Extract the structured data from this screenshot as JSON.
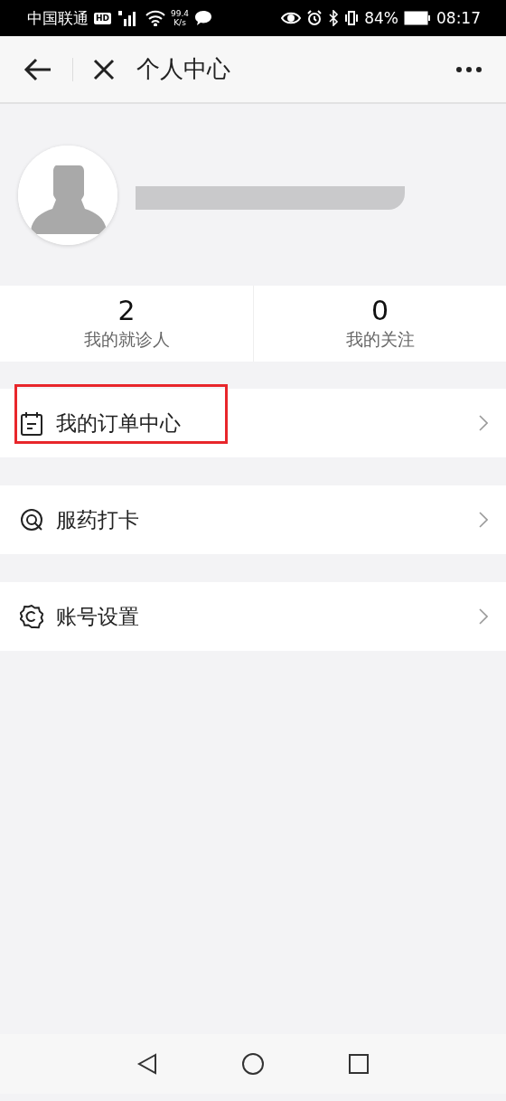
{
  "status_bar": {
    "carrier": "中国联通",
    "network_badge": "HD",
    "speed_value": "99.4",
    "speed_unit": "K/s",
    "battery_text": "84%",
    "time": "08:17"
  },
  "nav_bar": {
    "title": "个人中心"
  },
  "stats": [
    {
      "value": "2",
      "label": "我的就诊人"
    },
    {
      "value": "0",
      "label": "我的关注"
    }
  ],
  "menu": [
    {
      "label": "我的订单中心",
      "highlighted": true
    },
    {
      "label": "服药打卡",
      "highlighted": false
    },
    {
      "label": "账号设置",
      "highlighted": false
    }
  ]
}
